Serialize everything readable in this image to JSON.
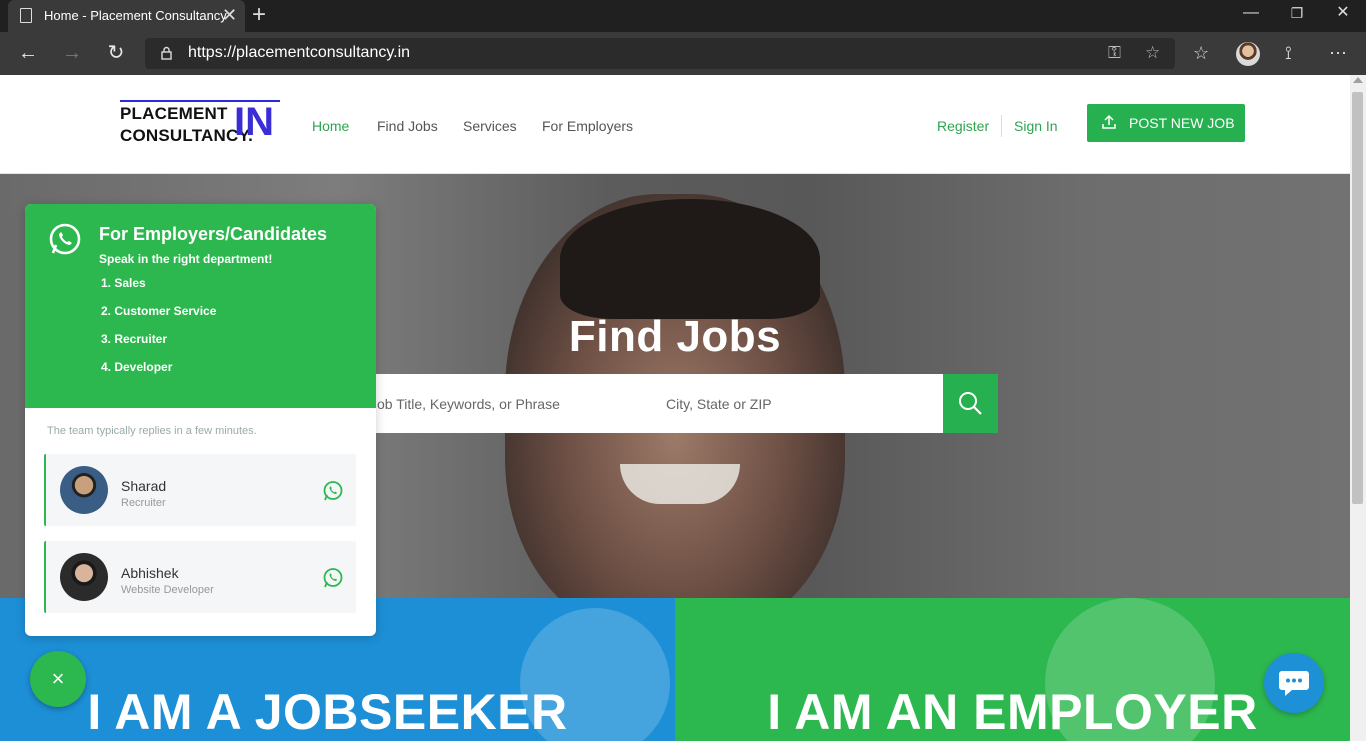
{
  "browser": {
    "tab_title": "Home - Placement Consultancy",
    "url": "https://placementconsultancy.in"
  },
  "site": {
    "logo_line1": "PLACEMENT",
    "logo_line2": "CONSULTANCY.",
    "logo_in": "IN",
    "nav": [
      "Home",
      "Find Jobs",
      "Services",
      "For Employers"
    ],
    "register": "Register",
    "signin": "Sign In",
    "post_job": "POST NEW JOB"
  },
  "hero": {
    "title": "Find Jobs",
    "keyword_placeholder": "Job Title, Keywords, or Phrase",
    "location_placeholder": "City, State or ZIP"
  },
  "banners": {
    "jobseeker": "I AM A JOBSEEKER",
    "employer": "I AM AN EMPLOYER"
  },
  "whatsapp": {
    "title": "For Employers/Candidates",
    "subtitle": "Speak in the right department!",
    "departments": [
      "1. Sales",
      "2. Customer Service",
      "3. Recruiter",
      "4. Developer"
    ],
    "reply_note": "The team typically replies in a few minutes.",
    "agents": [
      {
        "name": "Sharad",
        "role": "Recruiter"
      },
      {
        "name": "Abhishek",
        "role": "Website Developer"
      }
    ],
    "close": "×"
  },
  "colors": {
    "accent_green": "#26b050",
    "jobseeker_blue": "#1d8fd6",
    "logo_blue": "#3b2dd6"
  },
  "icons": [
    "document-icon",
    "close-icon",
    "plus-icon",
    "back-icon",
    "forward-icon",
    "refresh-icon",
    "lock-icon",
    "key-icon",
    "star-icon",
    "favorites-icon",
    "profile-icon",
    "read-aloud-icon",
    "more-icon",
    "upload-icon",
    "search-icon",
    "whatsapp-icon",
    "chat-icon"
  ]
}
